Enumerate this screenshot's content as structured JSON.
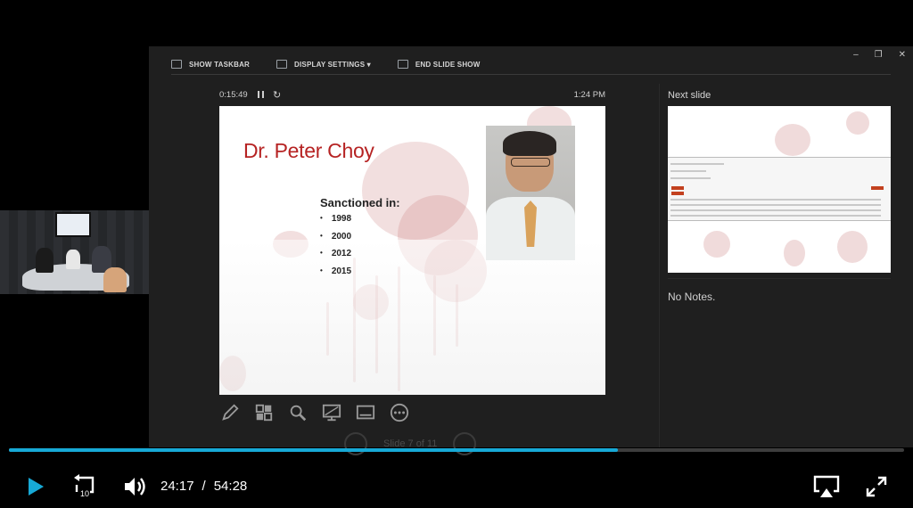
{
  "player": {
    "current_time": "24:17",
    "separator": "/",
    "duration": "54:28",
    "progress_fraction": 0.68,
    "buffered_fraction": 0.445,
    "rewind_seconds": "10",
    "accent_color": "#17a9d6"
  },
  "presenter": {
    "toolbar": {
      "show_taskbar": "SHOW TASKBAR",
      "display_settings": "DISPLAY SETTINGS ▾",
      "end_slide_show": "END SLIDE SHOW"
    },
    "window_controls": [
      "–",
      "❐",
      "✕"
    ],
    "elapsed_time": "0:15:49",
    "clock": "1:24 PM",
    "slide": {
      "title": "Dr. Peter Choy",
      "subheading": "Sanctioned in:",
      "bullet": "•",
      "years": [
        "1998",
        "2000",
        "2012",
        "2015"
      ],
      "title_color": "#b62323"
    },
    "next_slide_label": "Next slide",
    "notes_text": "No Notes.",
    "slide_counter": "Slide 7 of 11"
  },
  "icons": {
    "tools": [
      "pen-icon",
      "slides-grid-icon",
      "zoom-icon",
      "monitor-icon",
      "subtitles-icon",
      "more-options-icon"
    ]
  }
}
